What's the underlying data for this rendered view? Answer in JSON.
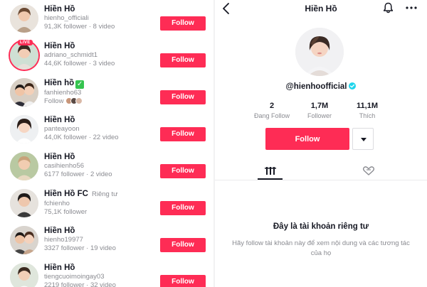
{
  "search_results": [
    {
      "name": "Hiền Hồ",
      "handle": "hienho_officiali",
      "meta": "91,3K follower · 8 video",
      "follow_label": "Follow",
      "avatar": "portrait-photo"
    },
    {
      "name": "Hiền Hồ",
      "handle": "adriano_schmidt1",
      "meta": "44,6K follower · 3 video",
      "follow_label": "Follow",
      "live_label": "LIVE",
      "avatar": "portrait-photo"
    },
    {
      "name": "Hiền hồ",
      "handle": "fanhienho63",
      "meta": "Follow",
      "follow_label": "Follow",
      "avatar": "couple-photo",
      "verified_icon": "check-box-icon"
    },
    {
      "name": "Hiền Hồ",
      "handle": "panteayoon",
      "meta": "44,0K follower · 22 video",
      "follow_label": "Follow",
      "avatar": "portrait-photo"
    },
    {
      "name": "Hiền Hồ",
      "handle": "casihienho56",
      "meta": "6177 follower · 2 video",
      "follow_label": "Follow",
      "avatar": "portrait-photo"
    },
    {
      "name": "Hiền Hồ FC",
      "tag": "Riêng tư",
      "handle": "fchienho",
      "meta": "75,1K follower",
      "follow_label": "Follow",
      "avatar": "portrait-photo"
    },
    {
      "name": "Hiền Hồ",
      "handle": "hienho19977",
      "meta": "3327 follower · 19 video",
      "follow_label": "Follow",
      "avatar": "couple-photo"
    },
    {
      "name": "Hiền Hồ",
      "handle": "tiengcuoimoingay03",
      "meta": "2219 follower · 32 video",
      "follow_label": "Follow",
      "avatar": "portrait-photo"
    }
  ],
  "profile": {
    "title": "Hiền Hồ",
    "username": "@hienhoofficial",
    "stats": [
      {
        "value": "2",
        "label": "Đang Follow"
      },
      {
        "value": "1,7M",
        "label": "Follower"
      },
      {
        "value": "11,1M",
        "label": "Thích"
      }
    ],
    "follow_label": "Follow",
    "private_title": "Đây là tài khoản riêng tư",
    "private_desc": "Hãy follow tài khoản này để xem nội dung và các tương tác của họ"
  },
  "icons": {
    "back": "chevron-left-icon",
    "notification": "bell-icon",
    "more": "more-dots-icon",
    "verified": "verified-badge-icon",
    "tab_videos": "grid-icon",
    "tab_liked": "liked-heart-icon",
    "dropdown": "caret-down-icon"
  },
  "colors": {
    "accent": "#fe2c55",
    "verified": "#20d5ec",
    "text": "#161823",
    "muted": "#8a8b91"
  }
}
